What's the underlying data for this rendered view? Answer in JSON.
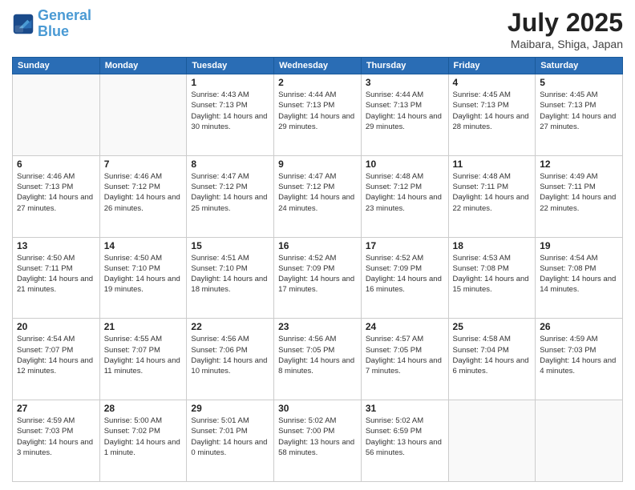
{
  "header": {
    "logo_line1": "General",
    "logo_line2": "Blue",
    "month": "July 2025",
    "location": "Maibara, Shiga, Japan"
  },
  "weekdays": [
    "Sunday",
    "Monday",
    "Tuesday",
    "Wednesday",
    "Thursday",
    "Friday",
    "Saturday"
  ],
  "weeks": [
    [
      {
        "day": "",
        "sunrise": "",
        "sunset": "",
        "daylight": ""
      },
      {
        "day": "",
        "sunrise": "",
        "sunset": "",
        "daylight": ""
      },
      {
        "day": "1",
        "sunrise": "Sunrise: 4:43 AM",
        "sunset": "Sunset: 7:13 PM",
        "daylight": "Daylight: 14 hours and 30 minutes."
      },
      {
        "day": "2",
        "sunrise": "Sunrise: 4:44 AM",
        "sunset": "Sunset: 7:13 PM",
        "daylight": "Daylight: 14 hours and 29 minutes."
      },
      {
        "day": "3",
        "sunrise": "Sunrise: 4:44 AM",
        "sunset": "Sunset: 7:13 PM",
        "daylight": "Daylight: 14 hours and 29 minutes."
      },
      {
        "day": "4",
        "sunrise": "Sunrise: 4:45 AM",
        "sunset": "Sunset: 7:13 PM",
        "daylight": "Daylight: 14 hours and 28 minutes."
      },
      {
        "day": "5",
        "sunrise": "Sunrise: 4:45 AM",
        "sunset": "Sunset: 7:13 PM",
        "daylight": "Daylight: 14 hours and 27 minutes."
      }
    ],
    [
      {
        "day": "6",
        "sunrise": "Sunrise: 4:46 AM",
        "sunset": "Sunset: 7:13 PM",
        "daylight": "Daylight: 14 hours and 27 minutes."
      },
      {
        "day": "7",
        "sunrise": "Sunrise: 4:46 AM",
        "sunset": "Sunset: 7:12 PM",
        "daylight": "Daylight: 14 hours and 26 minutes."
      },
      {
        "day": "8",
        "sunrise": "Sunrise: 4:47 AM",
        "sunset": "Sunset: 7:12 PM",
        "daylight": "Daylight: 14 hours and 25 minutes."
      },
      {
        "day": "9",
        "sunrise": "Sunrise: 4:47 AM",
        "sunset": "Sunset: 7:12 PM",
        "daylight": "Daylight: 14 hours and 24 minutes."
      },
      {
        "day": "10",
        "sunrise": "Sunrise: 4:48 AM",
        "sunset": "Sunset: 7:12 PM",
        "daylight": "Daylight: 14 hours and 23 minutes."
      },
      {
        "day": "11",
        "sunrise": "Sunrise: 4:48 AM",
        "sunset": "Sunset: 7:11 PM",
        "daylight": "Daylight: 14 hours and 22 minutes."
      },
      {
        "day": "12",
        "sunrise": "Sunrise: 4:49 AM",
        "sunset": "Sunset: 7:11 PM",
        "daylight": "Daylight: 14 hours and 22 minutes."
      }
    ],
    [
      {
        "day": "13",
        "sunrise": "Sunrise: 4:50 AM",
        "sunset": "Sunset: 7:11 PM",
        "daylight": "Daylight: 14 hours and 21 minutes."
      },
      {
        "day": "14",
        "sunrise": "Sunrise: 4:50 AM",
        "sunset": "Sunset: 7:10 PM",
        "daylight": "Daylight: 14 hours and 19 minutes."
      },
      {
        "day": "15",
        "sunrise": "Sunrise: 4:51 AM",
        "sunset": "Sunset: 7:10 PM",
        "daylight": "Daylight: 14 hours and 18 minutes."
      },
      {
        "day": "16",
        "sunrise": "Sunrise: 4:52 AM",
        "sunset": "Sunset: 7:09 PM",
        "daylight": "Daylight: 14 hours and 17 minutes."
      },
      {
        "day": "17",
        "sunrise": "Sunrise: 4:52 AM",
        "sunset": "Sunset: 7:09 PM",
        "daylight": "Daylight: 14 hours and 16 minutes."
      },
      {
        "day": "18",
        "sunrise": "Sunrise: 4:53 AM",
        "sunset": "Sunset: 7:08 PM",
        "daylight": "Daylight: 14 hours and 15 minutes."
      },
      {
        "day": "19",
        "sunrise": "Sunrise: 4:54 AM",
        "sunset": "Sunset: 7:08 PM",
        "daylight": "Daylight: 14 hours and 14 minutes."
      }
    ],
    [
      {
        "day": "20",
        "sunrise": "Sunrise: 4:54 AM",
        "sunset": "Sunset: 7:07 PM",
        "daylight": "Daylight: 14 hours and 12 minutes."
      },
      {
        "day": "21",
        "sunrise": "Sunrise: 4:55 AM",
        "sunset": "Sunset: 7:07 PM",
        "daylight": "Daylight: 14 hours and 11 minutes."
      },
      {
        "day": "22",
        "sunrise": "Sunrise: 4:56 AM",
        "sunset": "Sunset: 7:06 PM",
        "daylight": "Daylight: 14 hours and 10 minutes."
      },
      {
        "day": "23",
        "sunrise": "Sunrise: 4:56 AM",
        "sunset": "Sunset: 7:05 PM",
        "daylight": "Daylight: 14 hours and 8 minutes."
      },
      {
        "day": "24",
        "sunrise": "Sunrise: 4:57 AM",
        "sunset": "Sunset: 7:05 PM",
        "daylight": "Daylight: 14 hours and 7 minutes."
      },
      {
        "day": "25",
        "sunrise": "Sunrise: 4:58 AM",
        "sunset": "Sunset: 7:04 PM",
        "daylight": "Daylight: 14 hours and 6 minutes."
      },
      {
        "day": "26",
        "sunrise": "Sunrise: 4:59 AM",
        "sunset": "Sunset: 7:03 PM",
        "daylight": "Daylight: 14 hours and 4 minutes."
      }
    ],
    [
      {
        "day": "27",
        "sunrise": "Sunrise: 4:59 AM",
        "sunset": "Sunset: 7:03 PM",
        "daylight": "Daylight: 14 hours and 3 minutes."
      },
      {
        "day": "28",
        "sunrise": "Sunrise: 5:00 AM",
        "sunset": "Sunset: 7:02 PM",
        "daylight": "Daylight: 14 hours and 1 minute."
      },
      {
        "day": "29",
        "sunrise": "Sunrise: 5:01 AM",
        "sunset": "Sunset: 7:01 PM",
        "daylight": "Daylight: 14 hours and 0 minutes."
      },
      {
        "day": "30",
        "sunrise": "Sunrise: 5:02 AM",
        "sunset": "Sunset: 7:00 PM",
        "daylight": "Daylight: 13 hours and 58 minutes."
      },
      {
        "day": "31",
        "sunrise": "Sunrise: 5:02 AM",
        "sunset": "Sunset: 6:59 PM",
        "daylight": "Daylight: 13 hours and 56 minutes."
      },
      {
        "day": "",
        "sunrise": "",
        "sunset": "",
        "daylight": ""
      },
      {
        "day": "",
        "sunrise": "",
        "sunset": "",
        "daylight": ""
      }
    ]
  ]
}
